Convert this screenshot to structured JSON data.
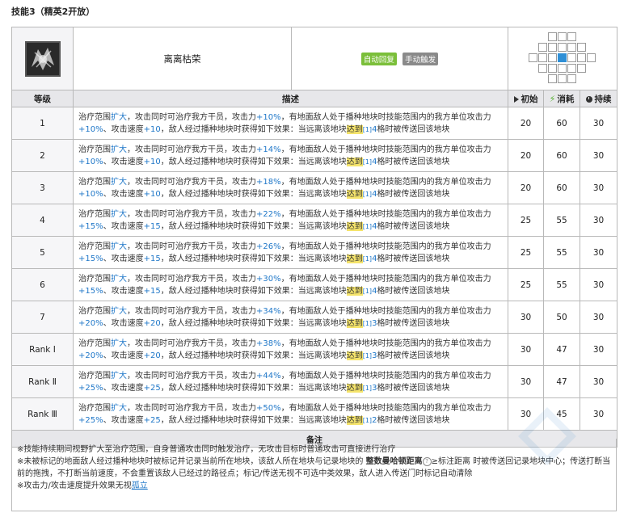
{
  "page_title": "技能3（精英2开放）",
  "skill": {
    "name": "离离枯荣",
    "tags": [
      "自动回复",
      "手动触发"
    ],
    "icon_name": "skill-icon"
  },
  "headers": {
    "level": "等级",
    "description": "描述",
    "sp_initial": "初始",
    "sp_cost": "消耗",
    "duration": "持续",
    "notes": "备注"
  },
  "rows": [
    {
      "level": "1",
      "atk": "+10%",
      "aspd": "+10",
      "range_atk": "+10%",
      "grids": "4",
      "init": "20",
      "cost": "60",
      "dur": "30"
    },
    {
      "level": "2",
      "atk": "+14%",
      "aspd": "+10",
      "range_atk": "+10%",
      "grids": "4",
      "init": "20",
      "cost": "60",
      "dur": "30"
    },
    {
      "level": "3",
      "atk": "+18%",
      "aspd": "+10",
      "range_atk": "+10%",
      "grids": "4",
      "init": "20",
      "cost": "60",
      "dur": "30"
    },
    {
      "level": "4",
      "atk": "+22%",
      "aspd": "+15",
      "range_atk": "+15%",
      "grids": "4",
      "init": "25",
      "cost": "55",
      "dur": "30"
    },
    {
      "level": "5",
      "atk": "+26%",
      "aspd": "+15",
      "range_atk": "+15%",
      "grids": "4",
      "init": "25",
      "cost": "55",
      "dur": "30"
    },
    {
      "level": "6",
      "atk": "+30%",
      "aspd": "+15",
      "range_atk": "+15%",
      "grids": "4",
      "init": "25",
      "cost": "55",
      "dur": "30"
    },
    {
      "level": "7",
      "atk": "+34%",
      "aspd": "+20",
      "range_atk": "+20%",
      "grids": "3",
      "init": "30",
      "cost": "50",
      "dur": "30"
    },
    {
      "level": "Rank Ⅰ",
      "atk": "+38%",
      "aspd": "+20",
      "range_atk": "+20%",
      "grids": "3",
      "init": "30",
      "cost": "47",
      "dur": "30"
    },
    {
      "level": "Rank Ⅱ",
      "atk": "+44%",
      "aspd": "+25",
      "range_atk": "+25%",
      "grids": "3",
      "init": "30",
      "cost": "47",
      "dur": "30"
    },
    {
      "level": "Rank Ⅲ",
      "atk": "+50%",
      "aspd": "+25",
      "range_atk": "+25%",
      "grids": "2",
      "init": "30",
      "cost": "45",
      "dur": "30"
    }
  ],
  "desc_parts": {
    "p1": "治疗范围",
    "expand": "扩大",
    "p2": "，攻击同时可治疗我方干员，攻击力",
    "p3": "，有地面敌人处于播种地块时技能范围内的我方单位攻击力",
    "p4": "、攻击速度",
    "p5": "，敌人经过播种地块时获得如下效果：当远离该地块",
    "reach": "达到",
    "ref": "[1]",
    "p6": "格时被传送回该地块"
  },
  "notes": {
    "line1": "※技能持续期间视野扩大至治疗范围，自身普通攻击同时触发治疗，无攻击目标时普通攻击可直接进行治疗",
    "line2a": "※未被标记的地面敌人经过播种地块时被标记并记录当前所在地块，该敌人所在地块与记录地块的",
    "line2b": "整数曼哈顿距离",
    "line2q": "?",
    "line2c": "≥标注距离 时被传送回记录地块中心；传送打断当前的拖拽，不打断当前速度，不会重置该敌人已经过的路径点；标记/传送无视不可选中类效果，敌人进入传送门时标记自动清除",
    "line3a": "※攻击力/攻击速度提升效果无视",
    "line3b": "孤立"
  }
}
